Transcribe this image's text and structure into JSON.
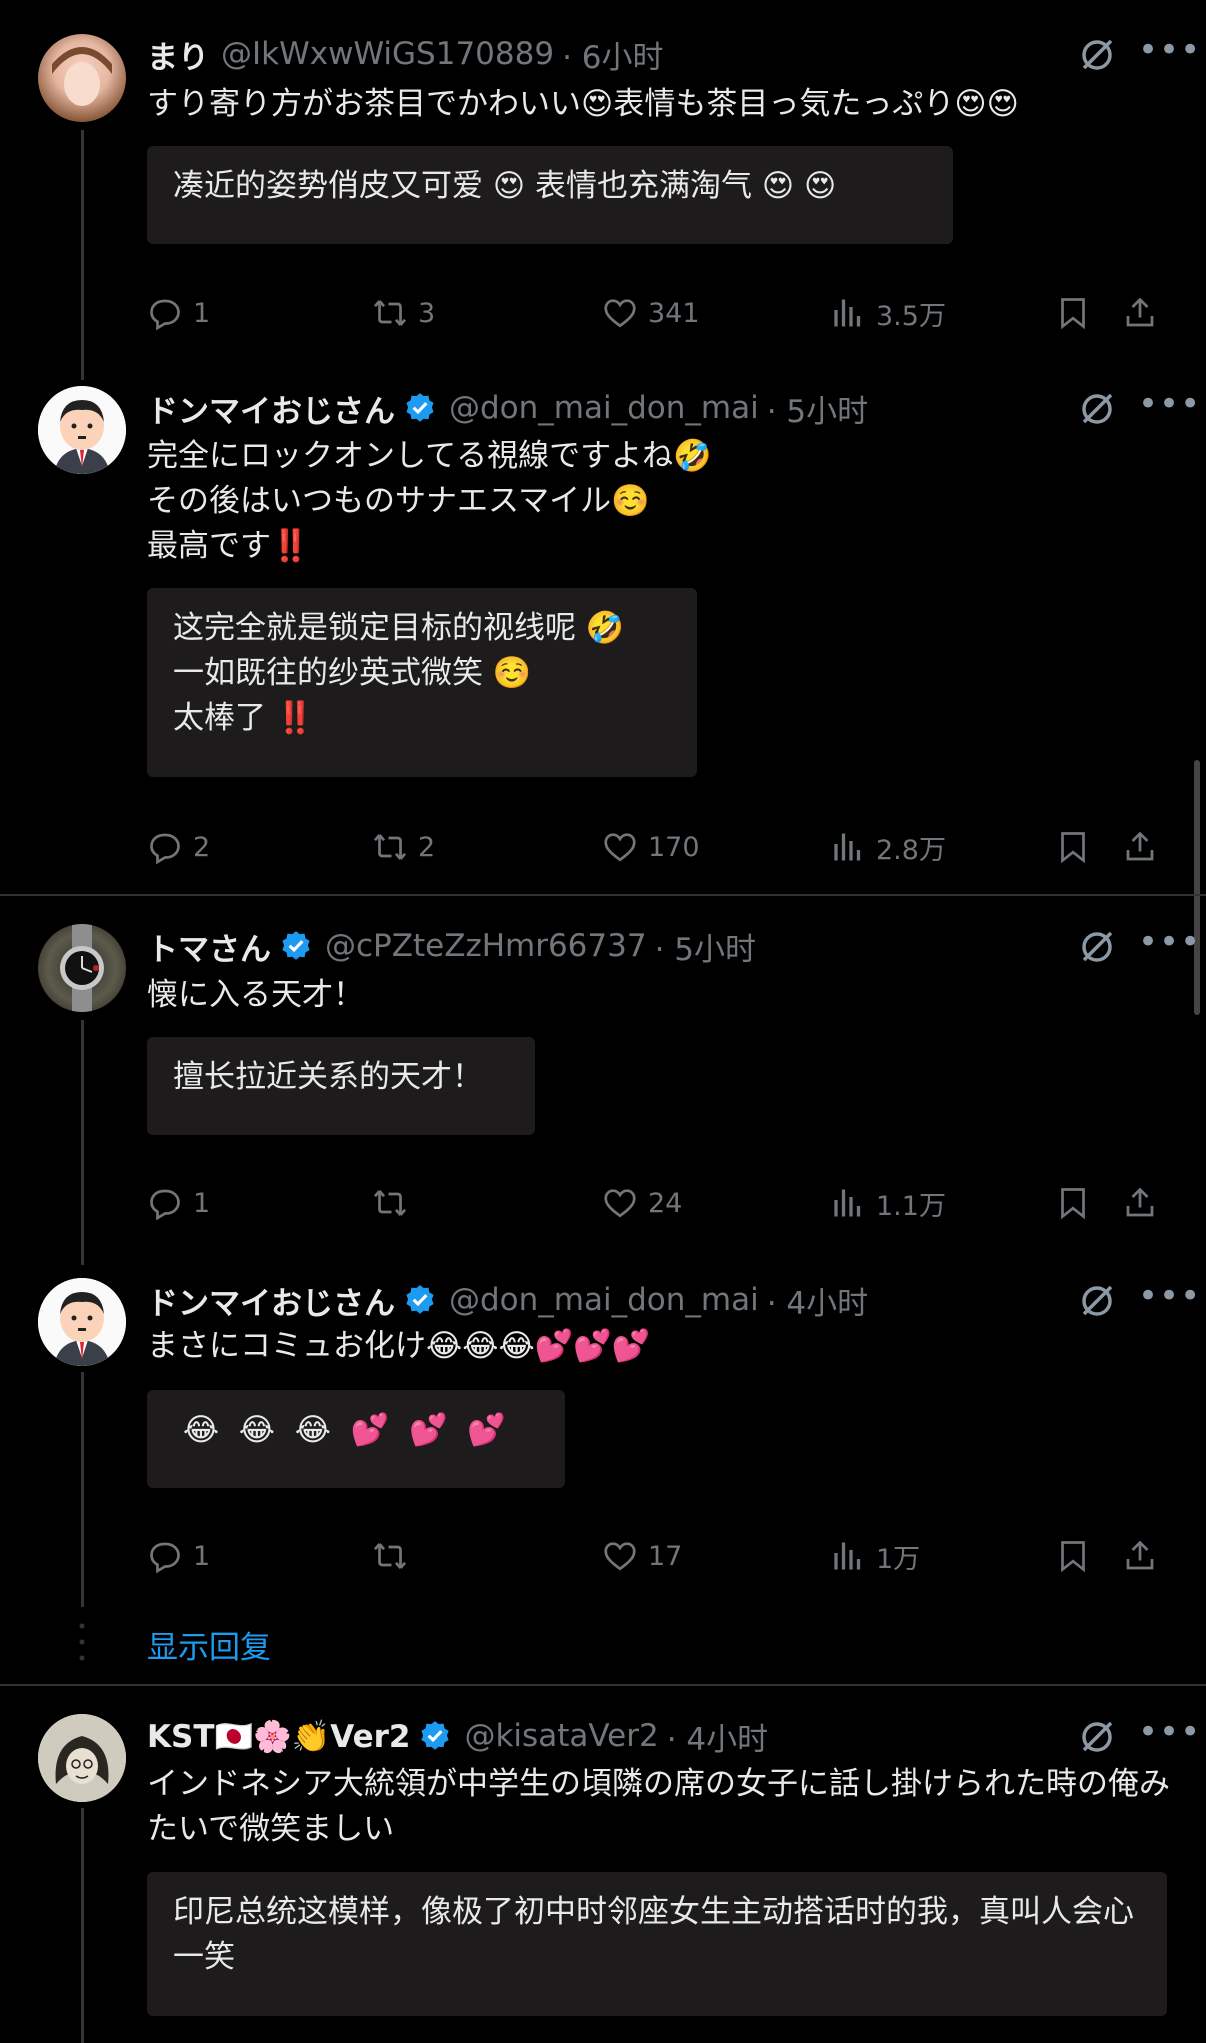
{
  "tweets": [
    {
      "name": "まり",
      "handle": "@IkWxwWiGS170889",
      "time": "· 6小时",
      "verified": false,
      "text": "すり寄り方がお茶目でかわいい😍表情も茶目っ気たっぷり😍😍",
      "translation": "凑近的姿势俏皮又可爱 😍 表情也充满淘气 😍 😍",
      "replies": "1",
      "retweets": "3",
      "likes": "341",
      "views": "3.5万"
    },
    {
      "name": "ドンマイおじさん",
      "handle": "@don_mai_don_mai",
      "time": "· 5小时",
      "verified": true,
      "text": "完全にロックオンしてる視線ですよね🤣\nその後はいつものサナエスマイル☺️\n最高です‼️",
      "translation": "这完全就是锁定目标的视线呢 🤣\n一如既往的纱英式微笑 ☺️\n太棒了 ‼️",
      "replies": "2",
      "retweets": "2",
      "likes": "170",
      "views": "2.8万"
    },
    {
      "name": "トマさん",
      "handle": "@cPZteZzHmr66737",
      "time": "· 5小时",
      "verified": true,
      "text": "懐に入る天才！",
      "translation": "擅长拉近关系的天才！",
      "replies": "1",
      "retweets": "",
      "likes": "24",
      "views": "1.1万"
    },
    {
      "name": "ドンマイおじさん",
      "handle": "@don_mai_don_mai",
      "time": "· 4小时",
      "verified": true,
      "text": "まさにコミュお化け😂😂😂💕💕💕",
      "translation": " 😂  😂  😂  💕  💕  💕",
      "replies": "1",
      "retweets": "",
      "likes": "17",
      "views": "1万"
    },
    {
      "name": "KST🇯🇵🌸👏Ver2",
      "handle": "@kisataVer2",
      "time": "· 4小时",
      "verified": true,
      "text": "インドネシア大統領が中学生の頃隣の席の女子に話し掛けられた時の俺みたいで微笑ましい",
      "translation": "印尼总统这模样，像极了初中时邻座女生主动搭话时的我，真叫人会心一笑"
    }
  ],
  "show_replies": "显示回复",
  "colors": {
    "background": "#000000",
    "text": "#e7e9ea",
    "muted": "#71767b",
    "accent": "#1d9bf0",
    "translation_box": "#1d1b1b"
  },
  "icons": [
    "reply-icon",
    "retweet-icon",
    "like-icon",
    "views-icon",
    "bookmark-icon",
    "share-icon",
    "grok-icon",
    "more-icon",
    "verified-icon"
  ]
}
